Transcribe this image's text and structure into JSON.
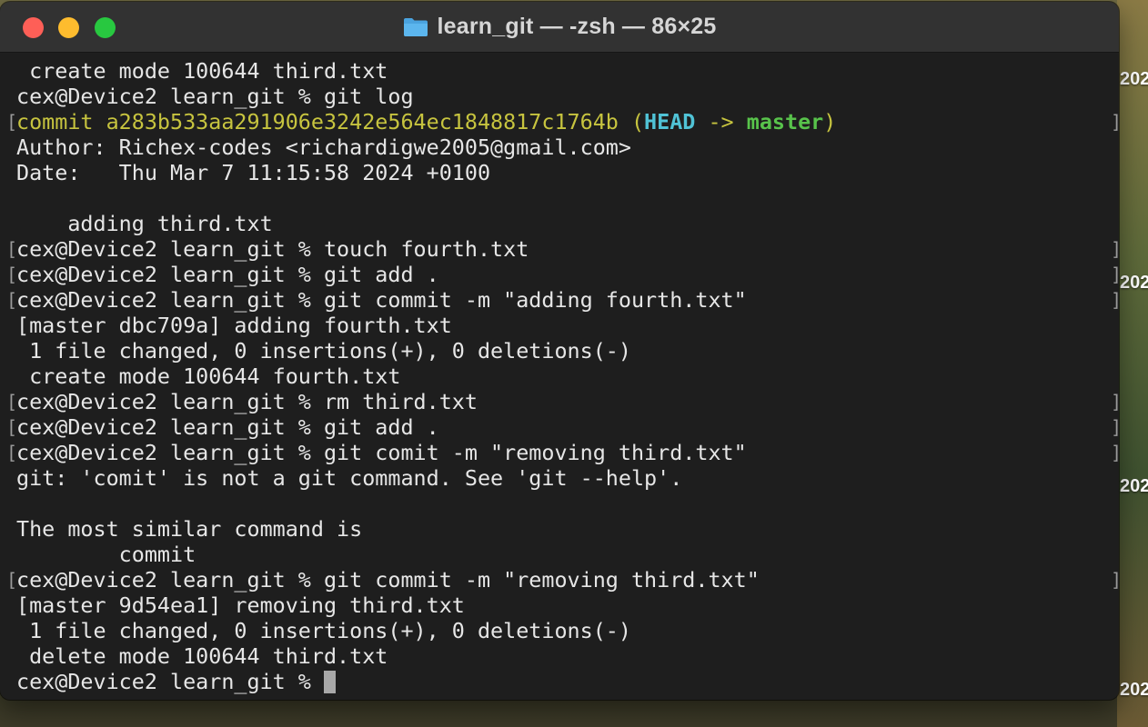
{
  "window": {
    "title": "learn_git — -zsh — 86×25"
  },
  "desktop": {
    "labels": [
      "202",
      "202",
      "202",
      "202"
    ]
  },
  "terminal": {
    "lines": [
      " create mode 100644 third.txt",
      "cex@Device2 learn_git % git log",
      "",
      "Author: Richex-codes <richardigwe2005@gmail.com>",
      "Date:   Thu Mar 7 11:15:58 2024 +0100",
      "",
      "    adding third.txt",
      "cex@Device2 learn_git % touch fourth.txt",
      "cex@Device2 learn_git % git add .",
      "cex@Device2 learn_git % git commit -m \"adding fourth.txt\"",
      "[master dbc709a] adding fourth.txt",
      " 1 file changed, 0 insertions(+), 0 deletions(-)",
      " create mode 100644 fourth.txt",
      "cex@Device2 learn_git % rm third.txt",
      "cex@Device2 learn_git % git add .",
      "cex@Device2 learn_git % git comit -m \"removing third.txt\"",
      "git: 'comit' is not a git command. See 'git --help'.",
      "",
      "The most similar command is",
      "        commit",
      "cex@Device2 learn_git % git commit -m \"removing third.txt\"",
      "[master 9d54ea1] removing third.txt",
      " 1 file changed, 0 insertions(+), 0 deletions(-)",
      " delete mode 100644 third.txt",
      "cex@Device2 learn_git % "
    ],
    "commit_line": {
      "prefix": "commit a283b533aa291906e3242e564ec1848817c1764b (",
      "head": "HEAD",
      "arrow": " -> ",
      "branch": "master",
      "suffix": ")"
    },
    "bracket_open": "[",
    "bracket_close": "]"
  },
  "colors": {
    "close": "#fe5f57",
    "minimize": "#febc2e",
    "maximize": "#28c840",
    "commit_text": "#c7c43f",
    "head": "#50c3d6",
    "branch": "#58c34b"
  }
}
